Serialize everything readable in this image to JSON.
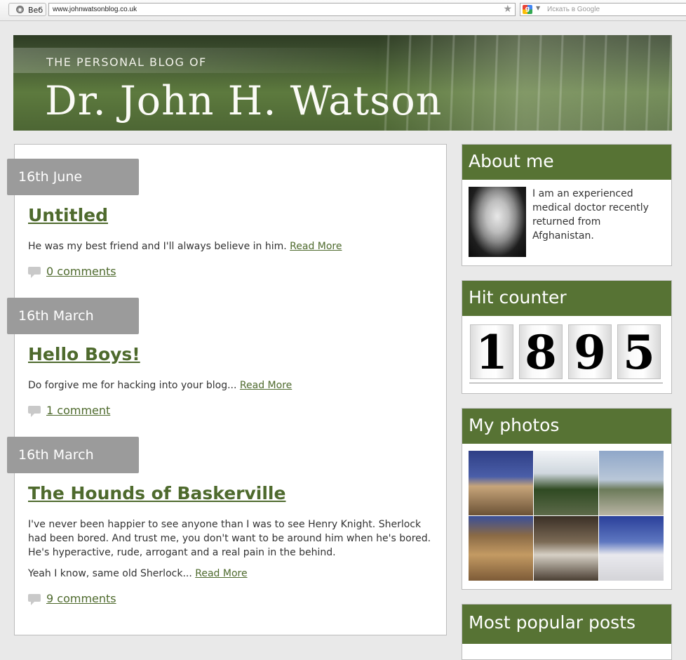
{
  "browser": {
    "web_label": "Веб",
    "url": "www.johnwatsonblog.co.uk",
    "search_placeholder": "Искать в Google",
    "search_logo": "g"
  },
  "header": {
    "subtitle": "THE PERSONAL BLOG OF",
    "title": "Dr. John H. Watson"
  },
  "posts": [
    {
      "date": "16th June",
      "title": "Untitled",
      "excerpt": [
        "He was my best friend and I'll always believe in him."
      ],
      "read_more": "Read More",
      "comments": "0 comments"
    },
    {
      "date": "16th March",
      "title": "Hello Boys!",
      "excerpt": [
        "Do forgive me for hacking into your blog..."
      ],
      "read_more": "Read More",
      "comments": "1 comment"
    },
    {
      "date": "16th March",
      "title": "The Hounds of Baskerville",
      "excerpt": [
        "I've never been happier to see anyone than I was to see Henry Knight. Sherlock had been bored. And trust me, you don't want to be around him when he's bored. He's hyperactive, rude, arrogant and a real pain in the behind.",
        "Yeah I know, same old Sherlock..."
      ],
      "read_more": "Read More",
      "comments": "9 comments"
    }
  ],
  "sidebar": {
    "about": {
      "heading": "About me",
      "text": "I am an experienced medical doctor recently returned from Afghanistan."
    },
    "counter": {
      "heading": "Hit counter",
      "digits": [
        "1",
        "8",
        "9",
        "5"
      ]
    },
    "photos": {
      "heading": "My photos",
      "items": [
        "colosseum-photo",
        "paris-trees-photo",
        "coast-photo",
        "colosseum-arches-photo",
        "hall-interior-photo",
        "sacre-coeur-photo"
      ]
    },
    "popular": {
      "heading": "Most popular posts"
    }
  },
  "colors": {
    "accent_green": "#577334",
    "link_green": "#4e6a2d",
    "date_tab_gray": "#9b9b9b"
  }
}
